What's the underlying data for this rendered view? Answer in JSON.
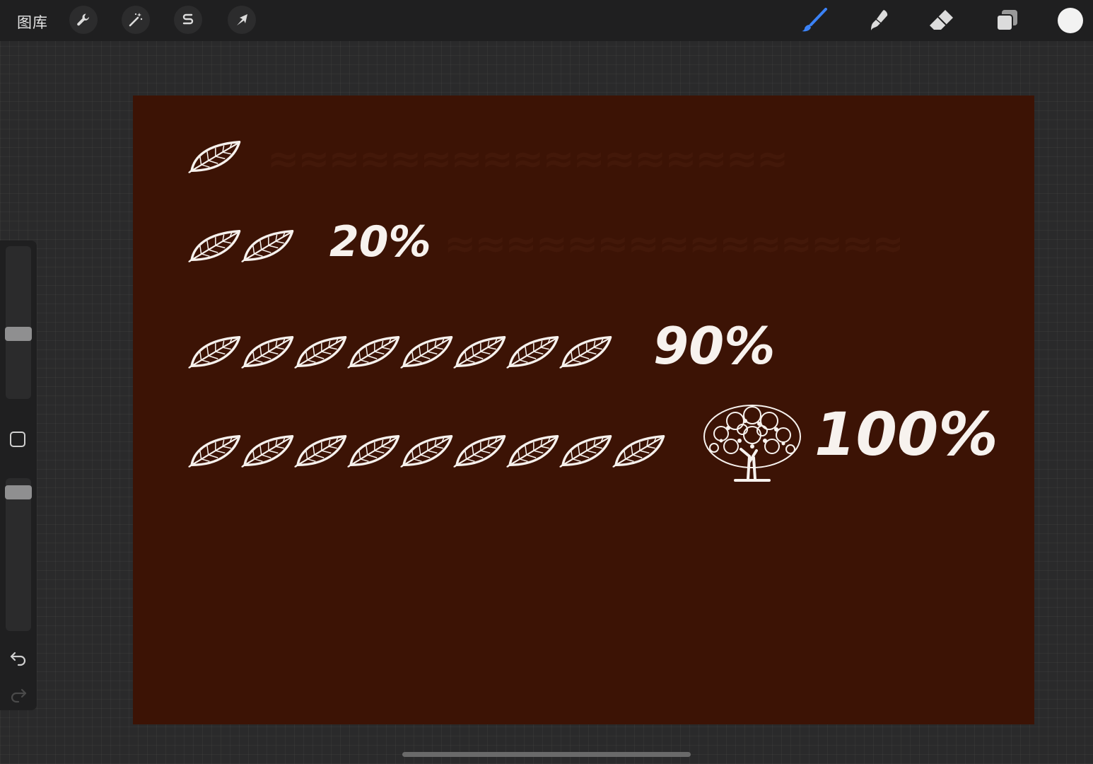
{
  "topbar": {
    "gallery_label": "图库",
    "tools_left": [
      {
        "name": "actions",
        "icon": "wrench-icon"
      },
      {
        "name": "adjustments",
        "icon": "magic-wand-icon"
      },
      {
        "name": "selection",
        "icon": "selection-s-icon"
      },
      {
        "name": "transform",
        "icon": "arrow-cursor-icon"
      }
    ],
    "tools_right": [
      {
        "name": "brush",
        "icon": "brush-icon",
        "active": true
      },
      {
        "name": "smudge",
        "icon": "smudge-icon"
      },
      {
        "name": "eraser",
        "icon": "eraser-icon"
      },
      {
        "name": "layers",
        "icon": "layers-icon"
      }
    ],
    "current_color": "#f2f2f2",
    "active_color": "#3b82f6"
  },
  "sidebar": {
    "brush_size_level": 0.42,
    "opacity_level": 0.95
  },
  "canvas": {
    "background_color": "#3c1305",
    "rows": [
      {
        "leaves": 1,
        "label": ""
      },
      {
        "leaves": 2,
        "label": "20%"
      },
      {
        "leaves": 8,
        "label": "90%"
      },
      {
        "leaves": 9,
        "label": "100%",
        "tree": true
      }
    ]
  }
}
